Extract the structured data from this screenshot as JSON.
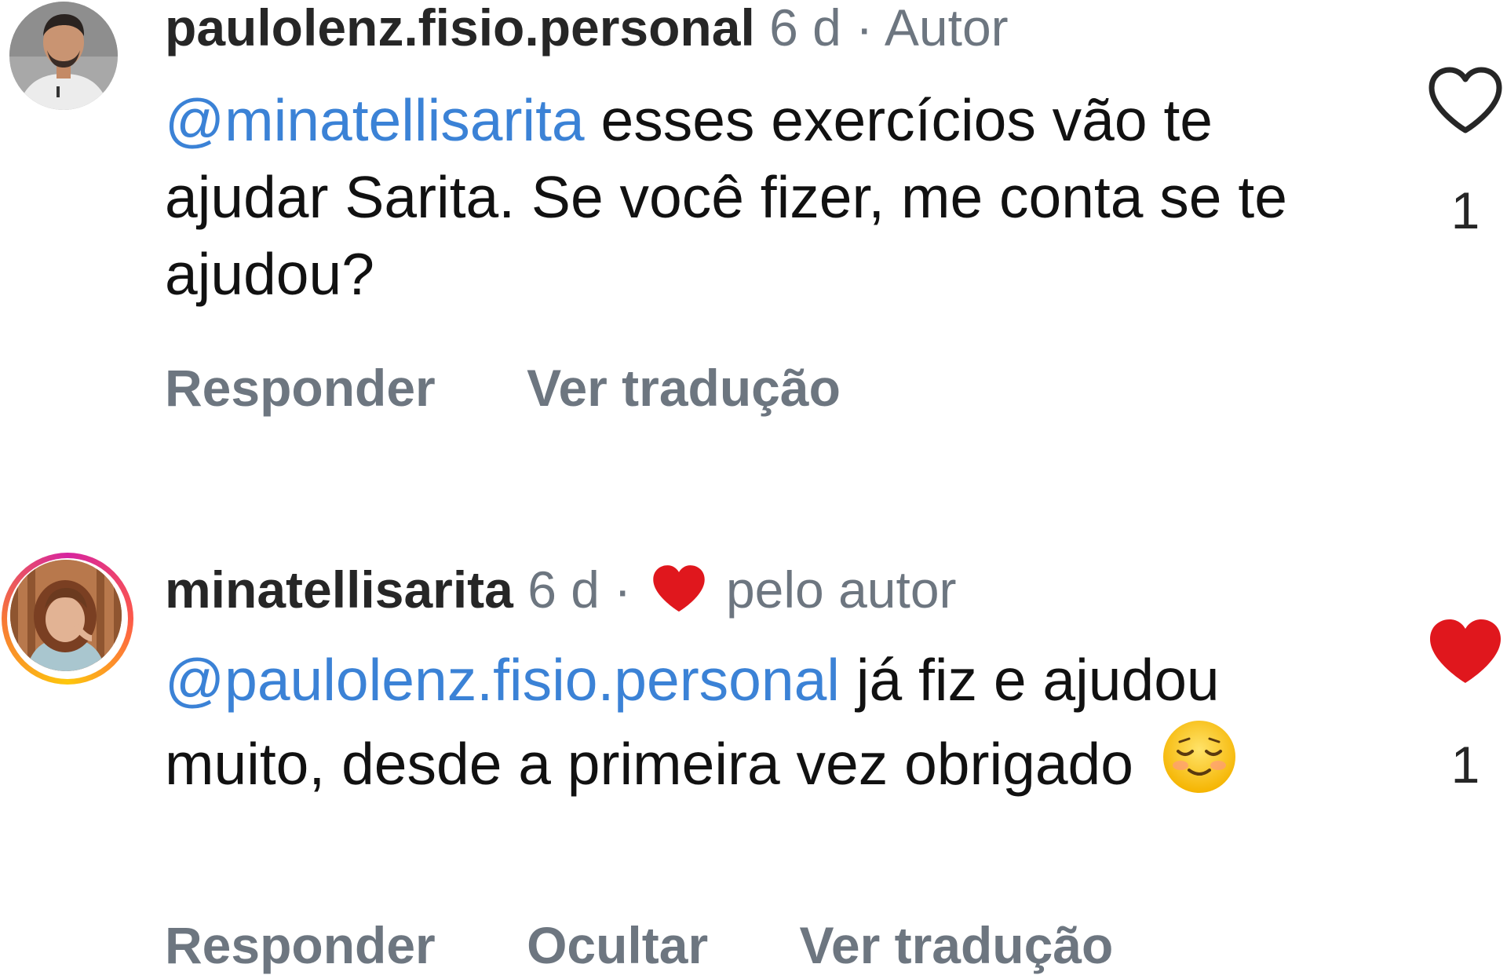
{
  "comments": [
    {
      "username": "paulolenz.fisio.personal",
      "time": "6 d",
      "separator": "·",
      "badge": "Autor",
      "mention": "@minatellisarita",
      "text": " esses exercícios vão te ajudar Sarita. Se você fizer, me conta se te ajudou?",
      "actions": {
        "reply": "Responder",
        "translate": "Ver tradução"
      },
      "like_count": "1",
      "liked": false,
      "avatar_icon": "profile-photo-man"
    },
    {
      "username": "minatellisarita",
      "time": "6 d",
      "separator": "·",
      "liked_by_author_label": "pelo autor",
      "mention": "@paulolenz.fisio.personal",
      "text": " já fiz e ajudou muito, desde a primeira vez obrigado ",
      "emoji": "smiling-face-emoji",
      "actions": {
        "reply": "Responder",
        "hide": "Ocultar",
        "translate": "Ver tradução"
      },
      "like_count": "1",
      "liked": true,
      "avatar_icon": "profile-photo-woman-story-ring"
    }
  ],
  "colors": {
    "mention": "#3b82d6",
    "meta": "#6d7680",
    "heart_red": "#e0171d",
    "text": "#111111"
  }
}
